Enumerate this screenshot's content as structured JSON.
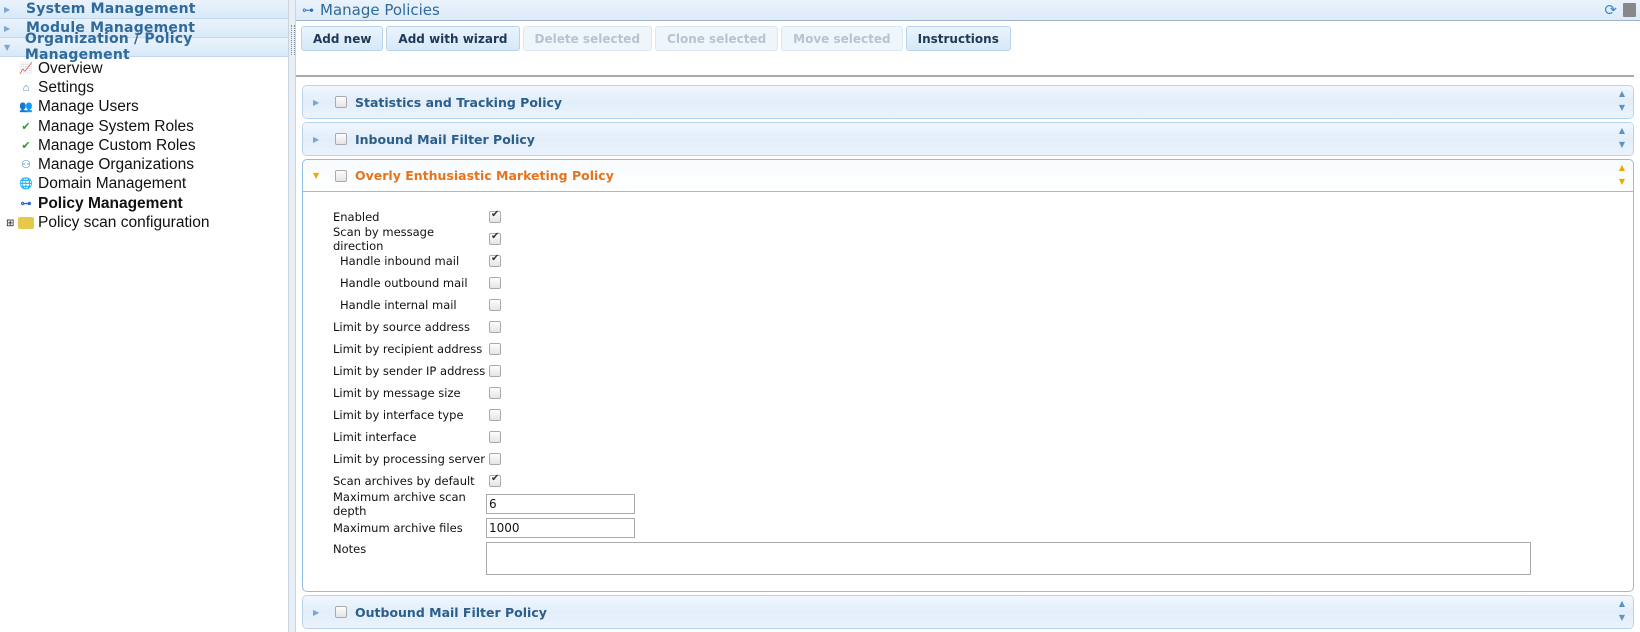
{
  "sidebar": {
    "headers": [
      "System Management",
      "Module Management",
      "Organization / Policy Management"
    ],
    "items": [
      {
        "label": "Overview",
        "icon": "chart-icon"
      },
      {
        "label": "Settings",
        "icon": "settings-home-icon"
      },
      {
        "label": "Manage Users",
        "icon": "users-icon"
      },
      {
        "label": "Manage System Roles",
        "icon": "role-icon"
      },
      {
        "label": "Manage Custom Roles",
        "icon": "role-icon"
      },
      {
        "label": "Manage Organizations",
        "icon": "organizations-icon"
      },
      {
        "label": "Domain Management",
        "icon": "globe-icon"
      },
      {
        "label": "Policy Management",
        "icon": "policy-icon"
      },
      {
        "label": "Policy scan configuration",
        "icon": "folder-icon"
      }
    ]
  },
  "main": {
    "title": "Manage Policies",
    "toolbar": [
      "Add new",
      "Add with wizard",
      "Delete selected",
      "Clone selected",
      "Move selected",
      "Instructions"
    ],
    "policies": [
      "Statistics and Tracking Policy",
      "Inbound Mail Filter Policy",
      "Overly Enthusiastic Marketing Policy",
      "Outbound Mail Filter Policy"
    ],
    "form": {
      "rows": [
        {
          "label": "Enabled",
          "checked": true
        },
        {
          "label": "Scan by message direction",
          "checked": true
        },
        {
          "label": "Handle inbound mail",
          "checked": true
        },
        {
          "label": "Handle outbound mail",
          "checked": false
        },
        {
          "label": "Handle internal mail",
          "checked": false
        },
        {
          "label": "Limit by source address",
          "checked": false
        },
        {
          "label": "Limit by recipient address",
          "checked": false
        },
        {
          "label": "Limit by sender IP address",
          "checked": false
        },
        {
          "label": "Limit by message size",
          "checked": false
        },
        {
          "label": "Limit by interface type",
          "checked": false
        },
        {
          "label": "Limit interface",
          "checked": false
        },
        {
          "label": "Limit by processing server",
          "checked": false
        },
        {
          "label": "Scan archives by default",
          "checked": true
        }
      ],
      "depth_label": "Maximum archive scan depth",
      "depth_value": "6",
      "files_label": "Maximum archive files",
      "files_value": "1000",
      "notes_label": "Notes",
      "notes_value": ""
    }
  },
  "colors": {
    "accent": "#2f6a9c",
    "active": "#e8731a"
  }
}
